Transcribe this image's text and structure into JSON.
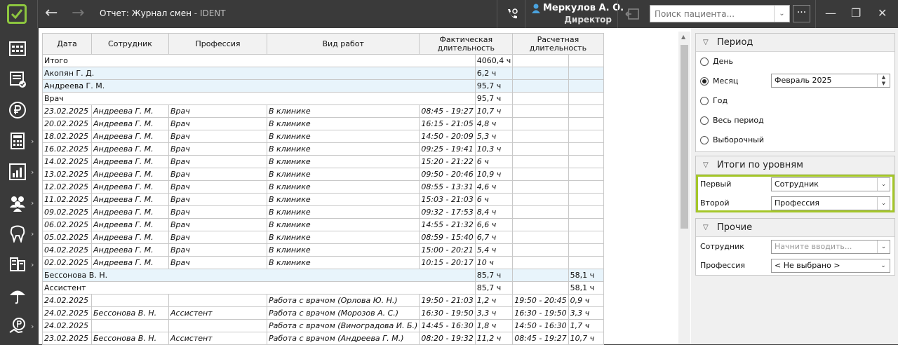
{
  "app": {
    "title": "Отчет: Журнал смен",
    "subtitle": "- IDENT",
    "user_name": "Меркулов А. О.",
    "user_role": "Директор",
    "search_placeholder": "Поиск пациента...",
    "more_label": "···",
    "accent_color": "#8dc63f"
  },
  "sidebar": {
    "items": [
      {
        "icon": "calendar-grid-icon",
        "has_chevron": false
      },
      {
        "icon": "list-check-icon",
        "has_chevron": false
      },
      {
        "icon": "ruble-icon",
        "has_chevron": false
      },
      {
        "icon": "calculator-icon",
        "has_chevron": true
      },
      {
        "icon": "bar-chart-icon",
        "has_chevron": true
      },
      {
        "icon": "people-icon",
        "has_chevron": true
      },
      {
        "icon": "tooth-icon",
        "has_chevron": true
      },
      {
        "icon": "documents-icon",
        "has_chevron": true
      },
      {
        "icon": "umbrella-icon",
        "has_chevron": false
      },
      {
        "icon": "ruble-hand-icon",
        "has_chevron": true
      }
    ]
  },
  "table": {
    "headers": [
      "Дата",
      "Сотрудник",
      "Профессия",
      "Вид работ",
      "Фактическая длительность",
      "Расчетная длительность"
    ],
    "rows": [
      {
        "type": "total",
        "label": "Итого",
        "fact": "4060,4 ч",
        "calc": ""
      },
      {
        "type": "emp",
        "label": "Акопян Г. Д.",
        "fact": "6,2 ч",
        "calc": ""
      },
      {
        "type": "emp",
        "label": "Андреева Г. М.",
        "fact": "95,7 ч",
        "calc": ""
      },
      {
        "type": "prof",
        "label": "Врач",
        "fact": "95,7 ч",
        "calc": ""
      },
      {
        "type": "detail",
        "date": "23.02.2025",
        "emp": "Андреева Г. М.",
        "prof": "Врач",
        "work": "В клинике",
        "time": "08:45 - 19:27",
        "fact": "10,7 ч",
        "calc_time": "",
        "calc": ""
      },
      {
        "type": "detail",
        "date": "20.02.2025",
        "emp": "Андреева Г. М.",
        "prof": "Врач",
        "work": "В клинике",
        "time": "16:15 - 21:05",
        "fact": "4,8 ч",
        "calc_time": "",
        "calc": ""
      },
      {
        "type": "detail",
        "date": "18.02.2025",
        "emp": "Андреева Г. М.",
        "prof": "Врач",
        "work": "В клинике",
        "time": "14:50 - 20:09",
        "fact": "5,3 ч",
        "calc_time": "",
        "calc": ""
      },
      {
        "type": "detail",
        "date": "16.02.2025",
        "emp": "Андреева Г. М.",
        "prof": "Врач",
        "work": "В клинике",
        "time": "09:25 - 19:41",
        "fact": "10,3 ч",
        "calc_time": "",
        "calc": ""
      },
      {
        "type": "detail",
        "date": "14.02.2025",
        "emp": "Андреева Г. М.",
        "prof": "Врач",
        "work": "В клинике",
        "time": "15:20 - 21:22",
        "fact": "6 ч",
        "calc_time": "",
        "calc": ""
      },
      {
        "type": "detail",
        "date": "13.02.2025",
        "emp": "Андреева Г. М.",
        "prof": "Врач",
        "work": "В клинике",
        "time": "09:50 - 20:46",
        "fact": "10,9 ч",
        "calc_time": "",
        "calc": ""
      },
      {
        "type": "detail",
        "date": "12.02.2025",
        "emp": "Андреева Г. М.",
        "prof": "Врач",
        "work": "В клинике",
        "time": "08:55 - 13:31",
        "fact": "4,6 ч",
        "calc_time": "",
        "calc": ""
      },
      {
        "type": "detail",
        "date": "11.02.2025",
        "emp": "Андреева Г. М.",
        "prof": "Врач",
        "work": "В клинике",
        "time": "15:03 - 21:03",
        "fact": "6 ч",
        "calc_time": "",
        "calc": ""
      },
      {
        "type": "detail",
        "date": "09.02.2025",
        "emp": "Андреева Г. М.",
        "prof": "Врач",
        "work": "В клинике",
        "time": "09:32 - 17:53",
        "fact": "8,4 ч",
        "calc_time": "",
        "calc": ""
      },
      {
        "type": "detail",
        "date": "06.02.2025",
        "emp": "Андреева Г. М.",
        "prof": "Врач",
        "work": "В клинике",
        "time": "14:55 - 21:32",
        "fact": "6,6 ч",
        "calc_time": "",
        "calc": ""
      },
      {
        "type": "detail",
        "date": "05.02.2025",
        "emp": "Андреева Г. М.",
        "prof": "Врач",
        "work": "В клинике",
        "time": "08:59 - 15:40",
        "fact": "6,7 ч",
        "calc_time": "",
        "calc": ""
      },
      {
        "type": "detail",
        "date": "04.02.2025",
        "emp": "Андреева Г. М.",
        "prof": "Врач",
        "work": "В клинике",
        "time": "15:00 - 20:21",
        "fact": "5,4 ч",
        "calc_time": "",
        "calc": ""
      },
      {
        "type": "detail",
        "date": "02.02.2025",
        "emp": "Андреева Г. М.",
        "prof": "Врач",
        "work": "В клинике",
        "time": "10:15 - 20:17",
        "fact": "10 ч",
        "calc_time": "",
        "calc": ""
      },
      {
        "type": "emp",
        "label": "Бессонова В. Н.",
        "fact": "85,7 ч",
        "calc": "58,1 ч"
      },
      {
        "type": "prof",
        "label": "Ассистент",
        "fact": "85,7 ч",
        "calc": "58,1 ч"
      },
      {
        "type": "detail",
        "date": "24.02.2025",
        "emp": "",
        "prof": "",
        "work": "Работа с врачом (Орлова Ю. Н.)",
        "time": "19:50 - 21:03",
        "fact": "1,2 ч",
        "calc_time": "19:50 - 20:45",
        "calc": "0,9 ч"
      },
      {
        "type": "detail",
        "date": "24.02.2025",
        "emp": "Бессонова В. Н.",
        "prof": "Ассистент",
        "work": "Работа с врачом (Морозов А. С.)",
        "time": "16:30 - 19:50",
        "fact": "3,3 ч",
        "calc_time": "16:30 - 19:50",
        "calc": "3,3 ч"
      },
      {
        "type": "detail",
        "date": "24.02.2025",
        "emp": "",
        "prof": "",
        "work": "Работа с врачом (Виноградова И. Б.)",
        "time": "14:45 - 16:30",
        "fact": "1,8 ч",
        "calc_time": "14:50 - 16:30",
        "calc": "1,7 ч"
      },
      {
        "type": "detail",
        "date": "23.02.2025",
        "emp": "Бессонова В. Н.",
        "prof": "Ассистент",
        "work": "Работа с врачом (Андреева Г. М.)",
        "time": "08:20 - 19:32",
        "fact": "11,2 ч",
        "calc_time": "08:45 - 19:27",
        "calc": "10,7 ч"
      }
    ]
  },
  "period": {
    "title": "Период",
    "options": [
      "День",
      "Месяц",
      "Год",
      "Весь период",
      "Выборочный"
    ],
    "selected": "Месяц",
    "month_value": "Февраль  2025"
  },
  "levels": {
    "title": "Итоги по уровням",
    "first_label": "Первый",
    "first_value": "Сотрудник",
    "second_label": "Второй",
    "second_value": "Профессия"
  },
  "other": {
    "title": "Прочие",
    "employee_label": "Сотрудник",
    "employee_placeholder": "Начните вводить...",
    "profession_label": "Профессия",
    "profession_value": "< Не выбрано >"
  }
}
